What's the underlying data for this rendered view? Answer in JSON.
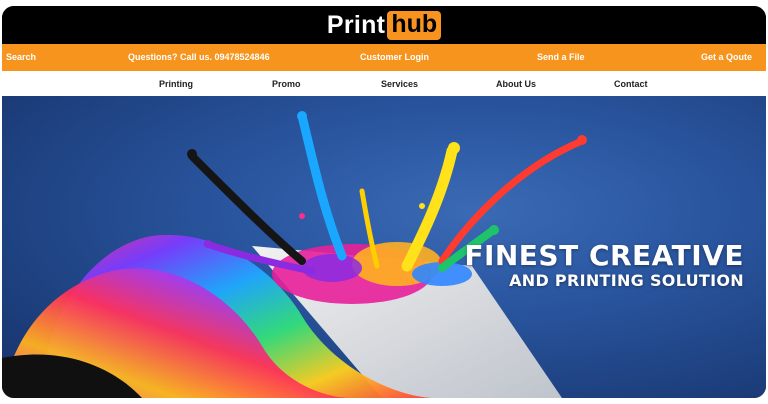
{
  "brand": {
    "print": "Print",
    "hub": "hub"
  },
  "utility_nav": {
    "search": "Search",
    "questions": "Questions? Call us. 09478524846",
    "customer_login": "Customer Login",
    "send_file": "Send a File",
    "get_quote": "Get a Qoute"
  },
  "main_nav": {
    "printing": "Printing",
    "promo": "Promo",
    "services": "Services",
    "about": "About Us",
    "contact": "Contact"
  },
  "hero": {
    "title_line1": "FINEST CREATIVE",
    "title_line2": "AND PRINTING SOLUTION"
  },
  "colors": {
    "accent_orange": "#f7941d",
    "header_black": "#000000",
    "hero_blue": "#2a56a0"
  }
}
